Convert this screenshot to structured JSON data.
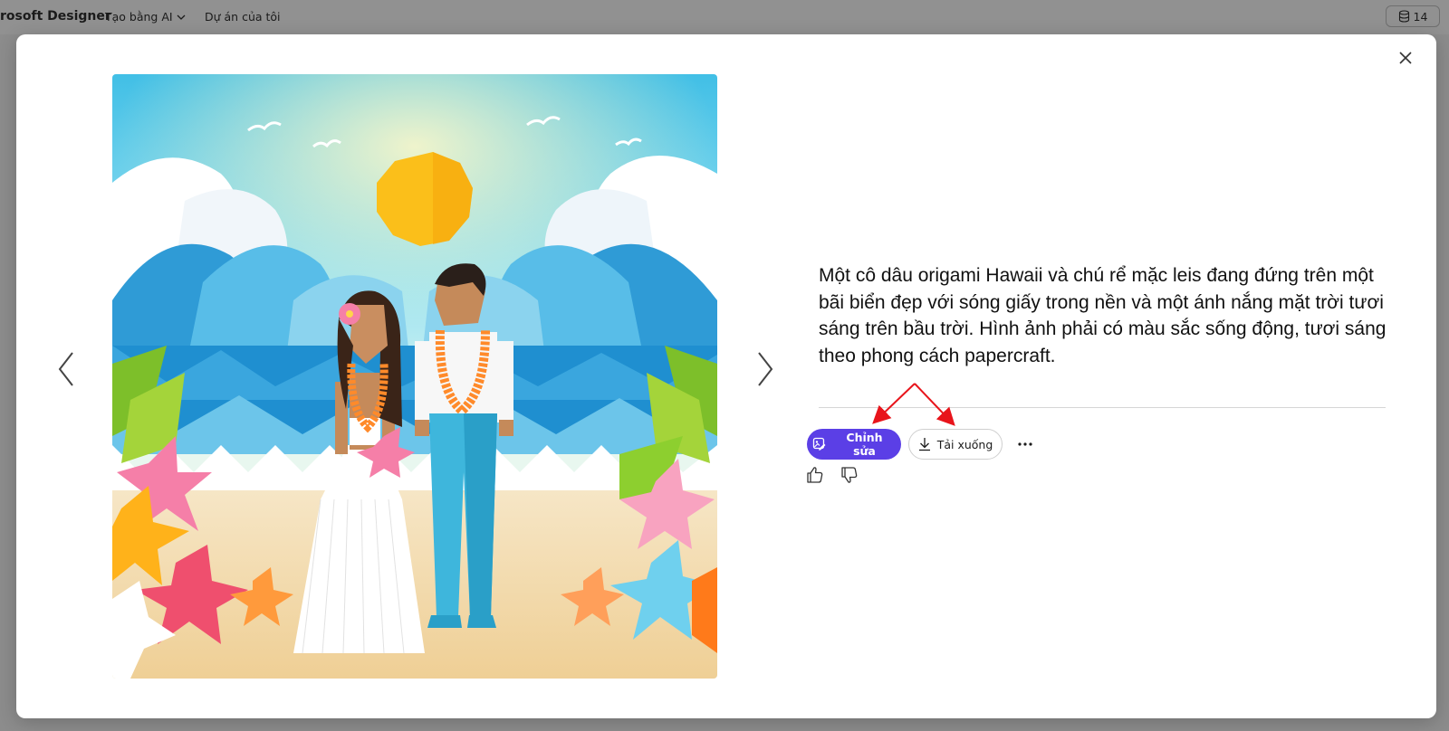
{
  "topbar": {
    "brand": "rosoft Designer",
    "create_ai": "Tạo bằng AI",
    "my_projects": "Dự án của tôi",
    "credits": "14"
  },
  "image": {
    "alt": "Papercraft Hawaiian origami bride and groom on beach with paper waves and sun"
  },
  "prompt": {
    "text": "Một cô dâu origami Hawaii và chú rể mặc leis đang đứng trên một bãi biển đẹp với sóng giấy trong nền và một ánh nắng mặt trời tươi sáng trên bầu trời. Hình ảnh phải có màu sắc sống động, tươi sáng theo phong cách papercraft."
  },
  "actions": {
    "edit_label": "Chỉnh sửa",
    "download_label": "Tải xuống"
  },
  "colors": {
    "accent": "#5b3fe6",
    "annotation": "#e8141b"
  },
  "icons": {
    "close": "close-icon",
    "prev": "chevron-left-icon",
    "next": "chevron-right-icon",
    "edit": "image-edit-icon",
    "download": "download-icon",
    "more": "more-icon",
    "like": "thumbs-up-icon",
    "dislike": "thumbs-down-icon",
    "credits": "coins-icon"
  }
}
